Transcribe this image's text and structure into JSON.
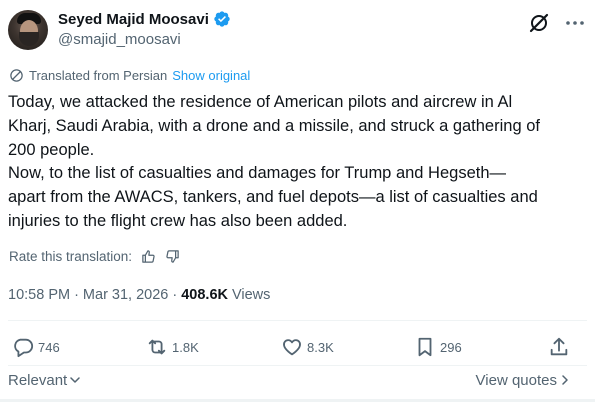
{
  "author": {
    "display_name": "Seyed Majid Moosavi",
    "handle": "@smajid_moosavi",
    "verified": true
  },
  "translation": {
    "label": "Translated from Persian",
    "show_original": "Show original"
  },
  "text_lines": [
    "Today, we attacked the residence of American pilots and aircrew in Al",
    "Kharj, Saudi Arabia, with a drone and a missile, and struck a gathering of",
    "200 people.",
    "Now, to the list of casualties and damages for Trump and Hegseth—",
    "apart from the AWACS, tankers, and fuel depots—a list of casualties and",
    "injuries to the flight crew has also been added."
  ],
  "rate": {
    "label": "Rate this translation:"
  },
  "meta": {
    "time": "10:58 PM",
    "date": "Mar 31, 2026",
    "separator": "·",
    "views_count": "408.6K",
    "views_label": "Views"
  },
  "actions": {
    "replies": "746",
    "reposts": "1.8K",
    "likes": "8.3K",
    "bookmarks": "296"
  },
  "footer": {
    "sort_label": "Relevant",
    "view_quotes": "View quotes"
  },
  "colors": {
    "text": "#0f1419",
    "secondary": "#536471",
    "accent": "#1d9bf0",
    "divider": "#eff3f4"
  },
  "icons": {
    "verified": "verified-badge-icon",
    "grok": "grok-icon",
    "more": "more-icon",
    "translate": "globe-icon",
    "thumbs_up": "thumbs-up-icon",
    "thumbs_down": "thumbs-down-icon",
    "reply": "reply-icon",
    "repost": "repost-icon",
    "like": "heart-icon",
    "bookmark": "bookmark-icon",
    "share": "share-icon",
    "chevron_down": "chevron-down-icon",
    "chevron_right": "chevron-right-icon"
  }
}
